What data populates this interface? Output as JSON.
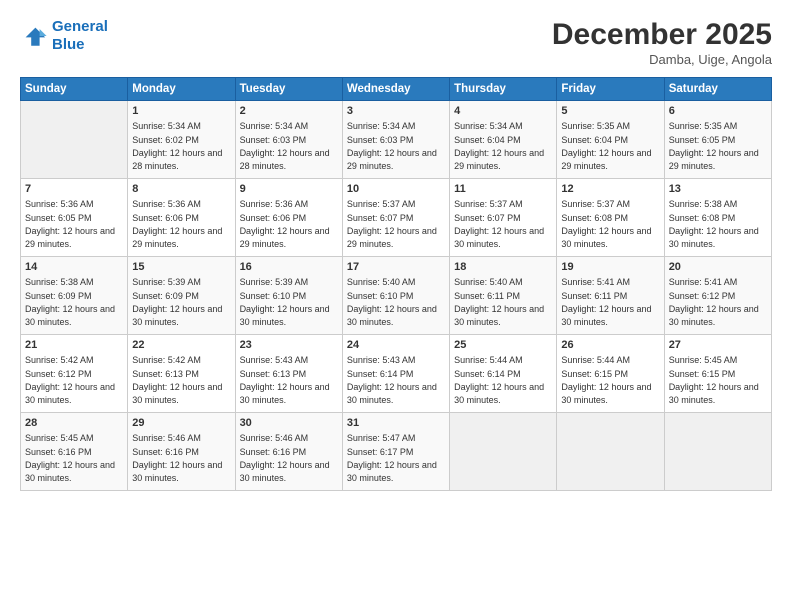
{
  "header": {
    "logo_line1": "General",
    "logo_line2": "Blue",
    "title": "December 2025",
    "location": "Damba, Uige, Angola"
  },
  "weekdays": [
    "Sunday",
    "Monday",
    "Tuesday",
    "Wednesday",
    "Thursday",
    "Friday",
    "Saturday"
  ],
  "weeks": [
    [
      {
        "day": "",
        "sunrise": "",
        "sunset": "",
        "daylight": ""
      },
      {
        "day": "1",
        "sunrise": "Sunrise: 5:34 AM",
        "sunset": "Sunset: 6:02 PM",
        "daylight": "Daylight: 12 hours and 28 minutes."
      },
      {
        "day": "2",
        "sunrise": "Sunrise: 5:34 AM",
        "sunset": "Sunset: 6:03 PM",
        "daylight": "Daylight: 12 hours and 28 minutes."
      },
      {
        "day": "3",
        "sunrise": "Sunrise: 5:34 AM",
        "sunset": "Sunset: 6:03 PM",
        "daylight": "Daylight: 12 hours and 29 minutes."
      },
      {
        "day": "4",
        "sunrise": "Sunrise: 5:34 AM",
        "sunset": "Sunset: 6:04 PM",
        "daylight": "Daylight: 12 hours and 29 minutes."
      },
      {
        "day": "5",
        "sunrise": "Sunrise: 5:35 AM",
        "sunset": "Sunset: 6:04 PM",
        "daylight": "Daylight: 12 hours and 29 minutes."
      },
      {
        "day": "6",
        "sunrise": "Sunrise: 5:35 AM",
        "sunset": "Sunset: 6:05 PM",
        "daylight": "Daylight: 12 hours and 29 minutes."
      }
    ],
    [
      {
        "day": "7",
        "sunrise": "Sunrise: 5:36 AM",
        "sunset": "Sunset: 6:05 PM",
        "daylight": "Daylight: 12 hours and 29 minutes."
      },
      {
        "day": "8",
        "sunrise": "Sunrise: 5:36 AM",
        "sunset": "Sunset: 6:06 PM",
        "daylight": "Daylight: 12 hours and 29 minutes."
      },
      {
        "day": "9",
        "sunrise": "Sunrise: 5:36 AM",
        "sunset": "Sunset: 6:06 PM",
        "daylight": "Daylight: 12 hours and 29 minutes."
      },
      {
        "day": "10",
        "sunrise": "Sunrise: 5:37 AM",
        "sunset": "Sunset: 6:07 PM",
        "daylight": "Daylight: 12 hours and 29 minutes."
      },
      {
        "day": "11",
        "sunrise": "Sunrise: 5:37 AM",
        "sunset": "Sunset: 6:07 PM",
        "daylight": "Daylight: 12 hours and 30 minutes."
      },
      {
        "day": "12",
        "sunrise": "Sunrise: 5:37 AM",
        "sunset": "Sunset: 6:08 PM",
        "daylight": "Daylight: 12 hours and 30 minutes."
      },
      {
        "day": "13",
        "sunrise": "Sunrise: 5:38 AM",
        "sunset": "Sunset: 6:08 PM",
        "daylight": "Daylight: 12 hours and 30 minutes."
      }
    ],
    [
      {
        "day": "14",
        "sunrise": "Sunrise: 5:38 AM",
        "sunset": "Sunset: 6:09 PM",
        "daylight": "Daylight: 12 hours and 30 minutes."
      },
      {
        "day": "15",
        "sunrise": "Sunrise: 5:39 AM",
        "sunset": "Sunset: 6:09 PM",
        "daylight": "Daylight: 12 hours and 30 minutes."
      },
      {
        "day": "16",
        "sunrise": "Sunrise: 5:39 AM",
        "sunset": "Sunset: 6:10 PM",
        "daylight": "Daylight: 12 hours and 30 minutes."
      },
      {
        "day": "17",
        "sunrise": "Sunrise: 5:40 AM",
        "sunset": "Sunset: 6:10 PM",
        "daylight": "Daylight: 12 hours and 30 minutes."
      },
      {
        "day": "18",
        "sunrise": "Sunrise: 5:40 AM",
        "sunset": "Sunset: 6:11 PM",
        "daylight": "Daylight: 12 hours and 30 minutes."
      },
      {
        "day": "19",
        "sunrise": "Sunrise: 5:41 AM",
        "sunset": "Sunset: 6:11 PM",
        "daylight": "Daylight: 12 hours and 30 minutes."
      },
      {
        "day": "20",
        "sunrise": "Sunrise: 5:41 AM",
        "sunset": "Sunset: 6:12 PM",
        "daylight": "Daylight: 12 hours and 30 minutes."
      }
    ],
    [
      {
        "day": "21",
        "sunrise": "Sunrise: 5:42 AM",
        "sunset": "Sunset: 6:12 PM",
        "daylight": "Daylight: 12 hours and 30 minutes."
      },
      {
        "day": "22",
        "sunrise": "Sunrise: 5:42 AM",
        "sunset": "Sunset: 6:13 PM",
        "daylight": "Daylight: 12 hours and 30 minutes."
      },
      {
        "day": "23",
        "sunrise": "Sunrise: 5:43 AM",
        "sunset": "Sunset: 6:13 PM",
        "daylight": "Daylight: 12 hours and 30 minutes."
      },
      {
        "day": "24",
        "sunrise": "Sunrise: 5:43 AM",
        "sunset": "Sunset: 6:14 PM",
        "daylight": "Daylight: 12 hours and 30 minutes."
      },
      {
        "day": "25",
        "sunrise": "Sunrise: 5:44 AM",
        "sunset": "Sunset: 6:14 PM",
        "daylight": "Daylight: 12 hours and 30 minutes."
      },
      {
        "day": "26",
        "sunrise": "Sunrise: 5:44 AM",
        "sunset": "Sunset: 6:15 PM",
        "daylight": "Daylight: 12 hours and 30 minutes."
      },
      {
        "day": "27",
        "sunrise": "Sunrise: 5:45 AM",
        "sunset": "Sunset: 6:15 PM",
        "daylight": "Daylight: 12 hours and 30 minutes."
      }
    ],
    [
      {
        "day": "28",
        "sunrise": "Sunrise: 5:45 AM",
        "sunset": "Sunset: 6:16 PM",
        "daylight": "Daylight: 12 hours and 30 minutes."
      },
      {
        "day": "29",
        "sunrise": "Sunrise: 5:46 AM",
        "sunset": "Sunset: 6:16 PM",
        "daylight": "Daylight: 12 hours and 30 minutes."
      },
      {
        "day": "30",
        "sunrise": "Sunrise: 5:46 AM",
        "sunset": "Sunset: 6:16 PM",
        "daylight": "Daylight: 12 hours and 30 minutes."
      },
      {
        "day": "31",
        "sunrise": "Sunrise: 5:47 AM",
        "sunset": "Sunset: 6:17 PM",
        "daylight": "Daylight: 12 hours and 30 minutes."
      },
      {
        "day": "",
        "sunrise": "",
        "sunset": "",
        "daylight": ""
      },
      {
        "day": "",
        "sunrise": "",
        "sunset": "",
        "daylight": ""
      },
      {
        "day": "",
        "sunrise": "",
        "sunset": "",
        "daylight": ""
      }
    ]
  ]
}
